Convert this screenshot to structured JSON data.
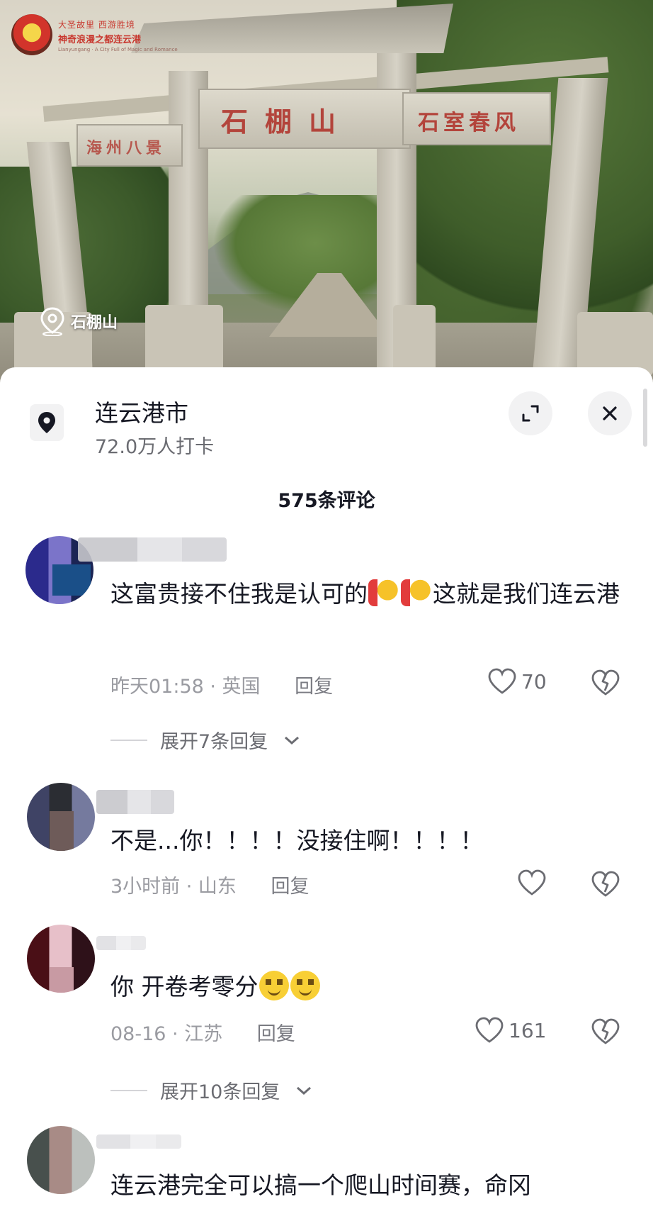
{
  "video": {
    "gate_main": "石棚山",
    "gate_left": "海州八景",
    "gate_right": "石室春风",
    "logo_line1": "大圣故里 西游胜境",
    "logo_line2": "神奇浪漫之都连云港",
    "logo_line3": "Lianyungang · A City Full of Magic and Romance",
    "location_label": "石棚山"
  },
  "header": {
    "city": "连云港市",
    "checkins": "72.0万人打卡"
  },
  "comments_title": "575条评论",
  "comments": [
    {
      "text_a": "这富贵接不住我是认可的",
      "text_b": "这就是我们连云港",
      "time": "昨天01:58 · 英国",
      "reply": "回复",
      "likes": "70",
      "expand": "展开7条回复"
    },
    {
      "text": "不是...你！！！！没接住啊！！！！",
      "time": "3小时前 · 山东",
      "reply": "回复",
      "likes": ""
    },
    {
      "text": "你 开卷考零分",
      "time": "08-16 · 江苏",
      "reply": "回复",
      "likes": "161",
      "expand": "展开10条回复"
    },
    {
      "text": "连云港完全可以搞一个爬山时间赛，命冈"
    }
  ],
  "icons": {
    "location": "location-pin-icon",
    "expand": "expand-icon",
    "close": "close-icon",
    "like": "heart-icon",
    "dislike": "broken-heart-icon",
    "chevron": "chevron-down-icon"
  }
}
